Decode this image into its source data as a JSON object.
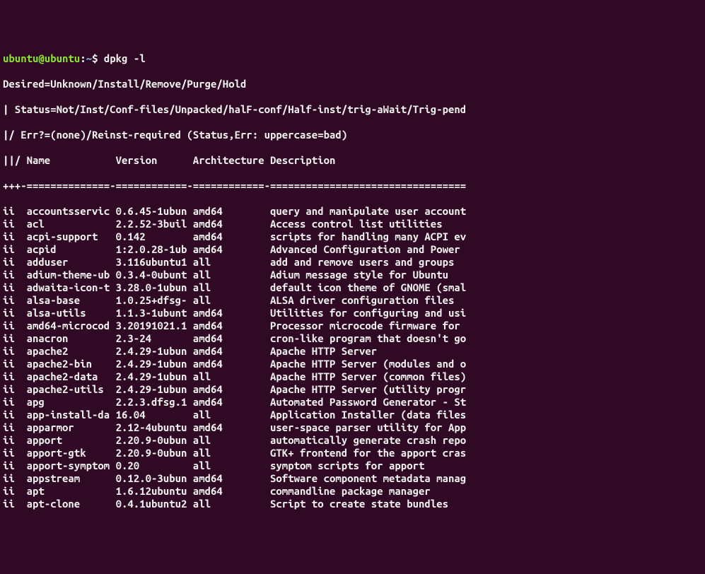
{
  "prompt": {
    "user_host": "ubuntu@ubuntu",
    "colon": ":",
    "path": "~",
    "dollar": "$ "
  },
  "command": "dpkg -l",
  "header": {
    "line1": "Desired=Unknown/Install/Remove/Purge/Hold",
    "line2": "| Status=Not/Inst/Conf-files/Unpacked/halF-conf/Half-inst/trig-aWait/Trig-pend",
    "line3": "|/ Err?=(none)/Reinst-required (Status,Err: uppercase=bad)",
    "columns_line": "||/ Name           Version      Architecture Description",
    "separator": "+++-==============-============-============-================================="
  },
  "packages": [
    {
      "status": "ii",
      "name": "accountsservic",
      "version": "0.6.45-1ubun",
      "arch": "amd64",
      "desc": "query and manipulate user account"
    },
    {
      "status": "ii",
      "name": "acl",
      "version": "2.2.52-3buil",
      "arch": "amd64",
      "desc": "Access control list utilities"
    },
    {
      "status": "ii",
      "name": "acpi-support",
      "version": "0.142",
      "arch": "amd64",
      "desc": "scripts for handling many ACPI ev"
    },
    {
      "status": "ii",
      "name": "acpid",
      "version": "1:2.0.28-1ub",
      "arch": "amd64",
      "desc": "Advanced Configuration and Power"
    },
    {
      "status": "ii",
      "name": "adduser",
      "version": "3.116ubuntu1",
      "arch": "all",
      "desc": "add and remove users and groups"
    },
    {
      "status": "ii",
      "name": "adium-theme-ub",
      "version": "0.3.4-0ubunt",
      "arch": "all",
      "desc": "Adium message style for Ubuntu"
    },
    {
      "status": "ii",
      "name": "adwaita-icon-t",
      "version": "3.28.0-1ubun",
      "arch": "all",
      "desc": "default icon theme of GNOME (smal"
    },
    {
      "status": "ii",
      "name": "alsa-base",
      "version": "1.0.25+dfsg-",
      "arch": "all",
      "desc": "ALSA driver configuration files"
    },
    {
      "status": "ii",
      "name": "alsa-utils",
      "version": "1.1.3-1ubunt",
      "arch": "amd64",
      "desc": "Utilities for configuring and usi"
    },
    {
      "status": "ii",
      "name": "amd64-microcod",
      "version": "3.20191021.1",
      "arch": "amd64",
      "desc": "Processor microcode firmware for"
    },
    {
      "status": "ii",
      "name": "anacron",
      "version": "2.3-24",
      "arch": "amd64",
      "desc": "cron-like program that doesn't go"
    },
    {
      "status": "ii",
      "name": "apache2",
      "version": "2.4.29-1ubun",
      "arch": "amd64",
      "desc": "Apache HTTP Server"
    },
    {
      "status": "ii",
      "name": "apache2-bin",
      "version": "2.4.29-1ubun",
      "arch": "amd64",
      "desc": "Apache HTTP Server (modules and o"
    },
    {
      "status": "ii",
      "name": "apache2-data",
      "version": "2.4.29-1ubun",
      "arch": "all",
      "desc": "Apache HTTP Server (common files)"
    },
    {
      "status": "ii",
      "name": "apache2-utils",
      "version": "2.4.29-1ubun",
      "arch": "amd64",
      "desc": "Apache HTTP Server (utility progr"
    },
    {
      "status": "ii",
      "name": "apg",
      "version": "2.2.3.dfsg.1",
      "arch": "amd64",
      "desc": "Automated Password Generator - St"
    },
    {
      "status": "ii",
      "name": "app-install-da",
      "version": "16.04",
      "arch": "all",
      "desc": "Application Installer (data files"
    },
    {
      "status": "ii",
      "name": "apparmor",
      "version": "2.12-4ubuntu",
      "arch": "amd64",
      "desc": "user-space parser utility for App"
    },
    {
      "status": "ii",
      "name": "apport",
      "version": "2.20.9-0ubun",
      "arch": "all",
      "desc": "automatically generate crash repo"
    },
    {
      "status": "ii",
      "name": "apport-gtk",
      "version": "2.20.9-0ubun",
      "arch": "all",
      "desc": "GTK+ frontend for the apport cras"
    },
    {
      "status": "ii",
      "name": "apport-symptom",
      "version": "0.20",
      "arch": "all",
      "desc": "symptom scripts for apport"
    },
    {
      "status": "ii",
      "name": "appstream",
      "version": "0.12.0-3ubun",
      "arch": "amd64",
      "desc": "Software component metadata manag"
    },
    {
      "status": "ii",
      "name": "apt",
      "version": "1.6.12ubuntu",
      "arch": "amd64",
      "desc": "commandline package manager"
    },
    {
      "status": "ii",
      "name": "apt-clone",
      "version": "0.4.1ubuntu2",
      "arch": "all",
      "desc": "Script to create state bundles"
    }
  ]
}
